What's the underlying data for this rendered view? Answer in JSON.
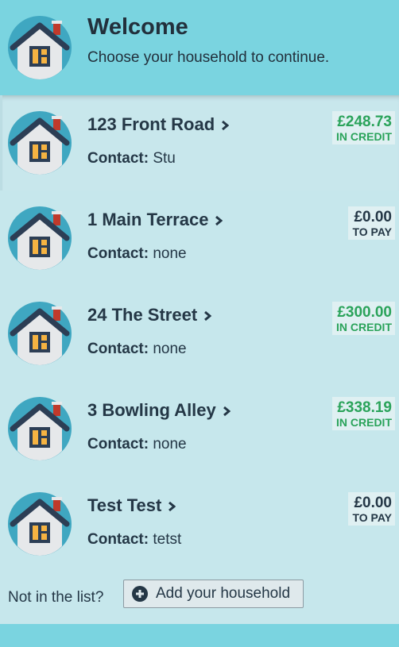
{
  "header": {
    "title": "Welcome",
    "subtitle": "Choose your household to continue."
  },
  "households": [
    {
      "name": "123 Front Road",
      "contact_label": "Contact:",
      "contact": "Stu",
      "amount": "£248.73",
      "status": "IN CREDIT",
      "type": "credit"
    },
    {
      "name": "1 Main Terrace",
      "contact_label": "Contact:",
      "contact": "none",
      "amount": "£0.00",
      "status": "TO PAY",
      "type": "pay"
    },
    {
      "name": "24 The Street",
      "contact_label": "Contact:",
      "contact": "none",
      "amount": "£300.00",
      "status": "IN CREDIT",
      "type": "credit"
    },
    {
      "name": "3 Bowling Alley",
      "contact_label": "Contact:",
      "contact": "none",
      "amount": "£338.19",
      "status": "IN CREDIT",
      "type": "credit"
    },
    {
      "name": "Test Test",
      "contact_label": "Contact:",
      "contact": "tetst",
      "amount": "£0.00",
      "status": "TO PAY",
      "type": "pay"
    }
  ],
  "footer": {
    "question": "Not in the list?",
    "add_label": "Add your household"
  },
  "icons": {
    "house": "house-icon",
    "chevron": "chevron-right-icon",
    "add": "plus-circle-icon"
  },
  "colors": {
    "header_bg": "#7ad4e0",
    "page_bg": "#c6e7ec",
    "credit": "#2aa35a",
    "text": "#243746"
  }
}
